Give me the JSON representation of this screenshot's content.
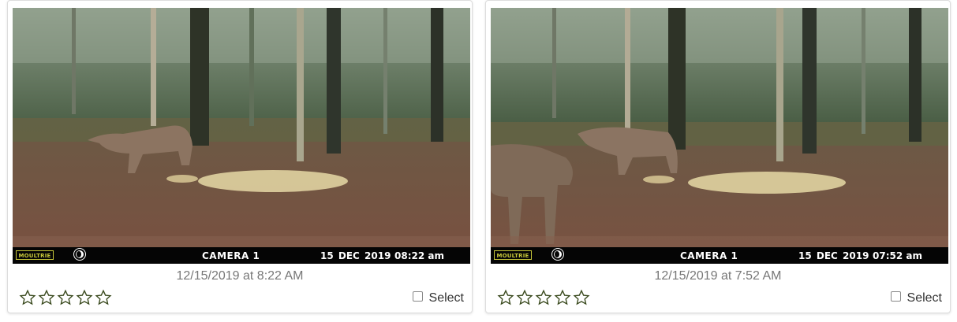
{
  "cards": [
    {
      "photo": {
        "brand": "MOULTRIE",
        "camera": "CAMERA 1",
        "date": "15 DEC 2019",
        "time": "08:22 am"
      },
      "timestamp": "12/15/2019 at 8:22 AM",
      "rating": 0,
      "select_label": "Select"
    },
    {
      "photo": {
        "brand": "MOULTRIE",
        "camera": "CAMERA 1",
        "date": "15 DEC 2019",
        "time": "07:52 am"
      },
      "timestamp": "12/15/2019 at 7:52 AM",
      "rating": 0,
      "select_label": "Select"
    }
  ],
  "colors": {
    "star_outline": "#3a4a1e",
    "timestamp_text": "#777777",
    "brand_green": "#c8c83a"
  },
  "icons": {
    "star": "star-outline-icon",
    "moon": "moon-phase-icon"
  }
}
